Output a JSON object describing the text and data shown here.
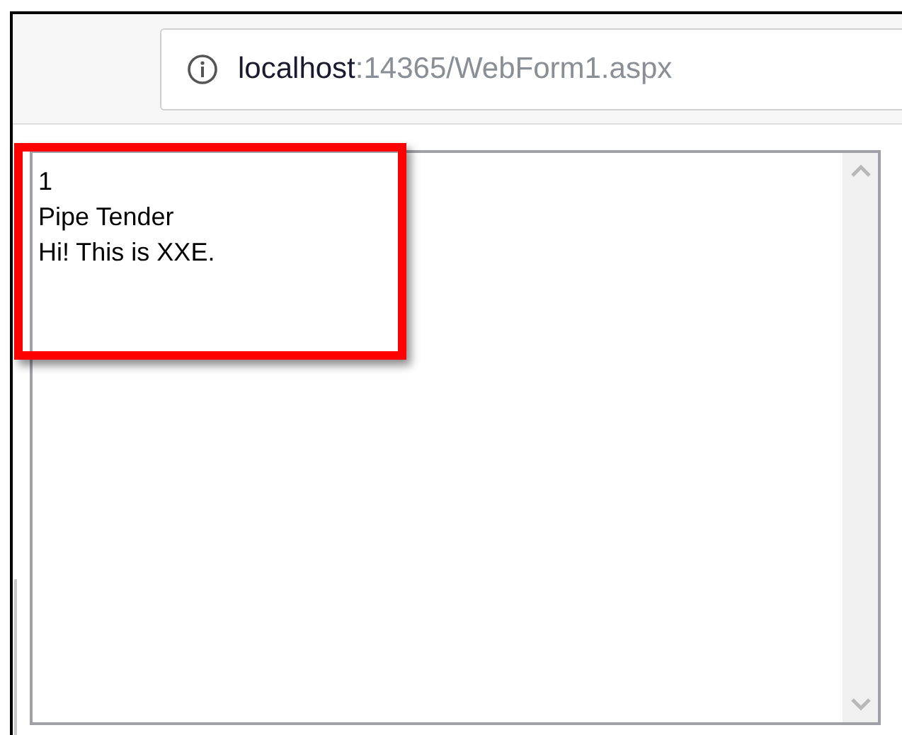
{
  "address_bar": {
    "host": "localhost",
    "path": ":14365/WebForm1.aspx"
  },
  "textarea": {
    "lines": [
      "1",
      "Pipe Tender",
      "Hi! This is XXE."
    ]
  },
  "highlight": {
    "color": "#ff0000"
  }
}
